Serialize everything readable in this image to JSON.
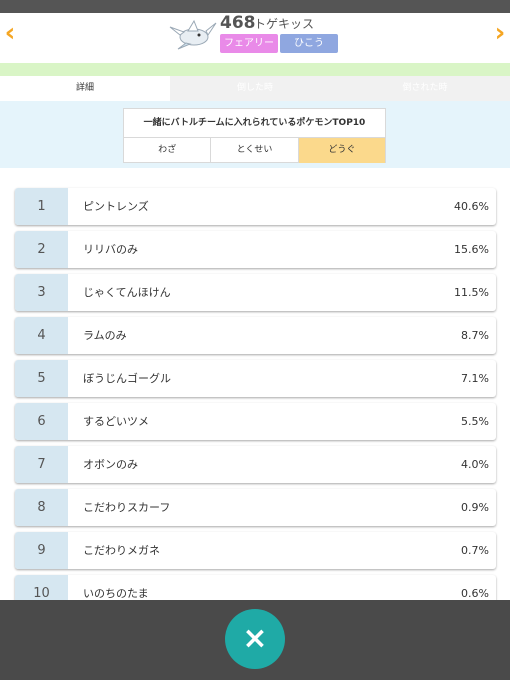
{
  "header": {
    "pokemon_number": "468",
    "pokemon_name": "トゲキッス",
    "types": [
      "フェアリー",
      "ひこう"
    ],
    "prev_icon": "chevron-left-icon",
    "next_icon": "chevron-right-icon"
  },
  "tabs": [
    {
      "label": "詳細",
      "active": true
    },
    {
      "label": "倒した時",
      "active": false
    },
    {
      "label": "倒された時",
      "active": false
    }
  ],
  "filter": {
    "title": "一緒にバトルチームに入れられているポケモンTOP10",
    "options": [
      {
        "label": "わざ",
        "selected": false
      },
      {
        "label": "とくせい",
        "selected": false
      },
      {
        "label": "どうぐ",
        "selected": true
      }
    ]
  },
  "ranking": [
    {
      "rank": "1",
      "name": "ピントレンズ",
      "percent": "40.6%"
    },
    {
      "rank": "2",
      "name": "リリバのみ",
      "percent": "15.6%"
    },
    {
      "rank": "3",
      "name": "じゃくてんほけん",
      "percent": "11.5%"
    },
    {
      "rank": "4",
      "name": "ラムのみ",
      "percent": "8.7%"
    },
    {
      "rank": "5",
      "name": "ぼうじんゴーグル",
      "percent": "7.1%"
    },
    {
      "rank": "6",
      "name": "するどいツメ",
      "percent": "5.5%"
    },
    {
      "rank": "7",
      "name": "オボンのみ",
      "percent": "4.0%"
    },
    {
      "rank": "8",
      "name": "こだわりスカーフ",
      "percent": "0.9%"
    },
    {
      "rank": "9",
      "name": "こだわりメガネ",
      "percent": "0.7%"
    },
    {
      "rank": "10",
      "name": "いのちのたま",
      "percent": "0.6%"
    }
  ],
  "close_button": {
    "icon": "close-icon",
    "glyph": "×"
  },
  "colors": {
    "accent_arrow": "#f5a623",
    "fairy": "#e98ae8",
    "flying": "#8fa7e0",
    "selected_filter": "#fbd98c",
    "close_button": "#1faaa6"
  }
}
